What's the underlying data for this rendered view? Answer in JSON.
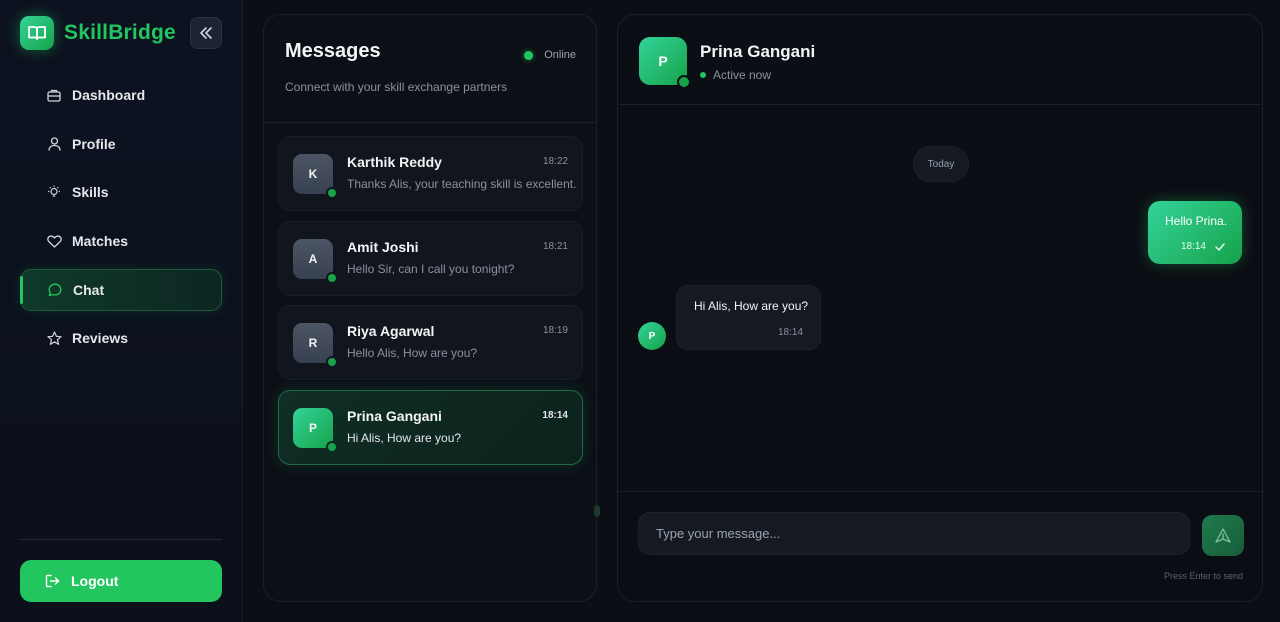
{
  "brand": {
    "name": "SkillBridge",
    "logo_icon": "book-icon"
  },
  "sidebar": {
    "collapse_icon": "chevrons-left-icon",
    "items": [
      {
        "label": "Dashboard",
        "icon": "briefcase-icon",
        "active": false
      },
      {
        "label": "Profile",
        "icon": "user-icon",
        "active": false
      },
      {
        "label": "Skills",
        "icon": "lightbulb-icon",
        "active": false
      },
      {
        "label": "Matches",
        "icon": "heart-icon",
        "active": false
      },
      {
        "label": "Chat",
        "icon": "message-circle-icon",
        "active": true
      },
      {
        "label": "Reviews",
        "icon": "star-icon",
        "active": false
      }
    ],
    "logout_label": "Logout"
  },
  "messages": {
    "title": "Messages",
    "online_label": "Online",
    "subtitle": "Connect with your skill exchange partners",
    "conversations": [
      {
        "initial": "K",
        "name": "Karthik Reddy",
        "time": "18:22",
        "preview": "Thanks Alis, your teaching skill is excellent."
      },
      {
        "initial": "A",
        "name": "Amit Joshi",
        "time": "18:21",
        "preview": "Hello Sir, can I call you tonight?"
      },
      {
        "initial": "R",
        "name": "Riya Agarwal",
        "time": "18:19",
        "preview": "Hello Alis, How are you?"
      },
      {
        "initial": "P",
        "name": "Prina Gangani",
        "time": "18:14",
        "preview": "Hi Alis, How are you?",
        "active": true
      }
    ]
  },
  "chat": {
    "contact_initial": "P",
    "contact_name": "Prina Gangani",
    "contact_status": "Active now",
    "day_label": "Today",
    "outgoing": {
      "text": "Hello Prina.",
      "time": "18:14",
      "status_icon": "check-icon"
    },
    "incoming": {
      "sender_initial": "P",
      "text": "Hi Alis, How are you?",
      "time": "18:14"
    },
    "input_placeholder": "Type your message...",
    "send_icon": "send-icon",
    "hint": "Press Enter to send"
  },
  "colors": {
    "accent": "#22c55e",
    "background": "#0b0e14"
  }
}
